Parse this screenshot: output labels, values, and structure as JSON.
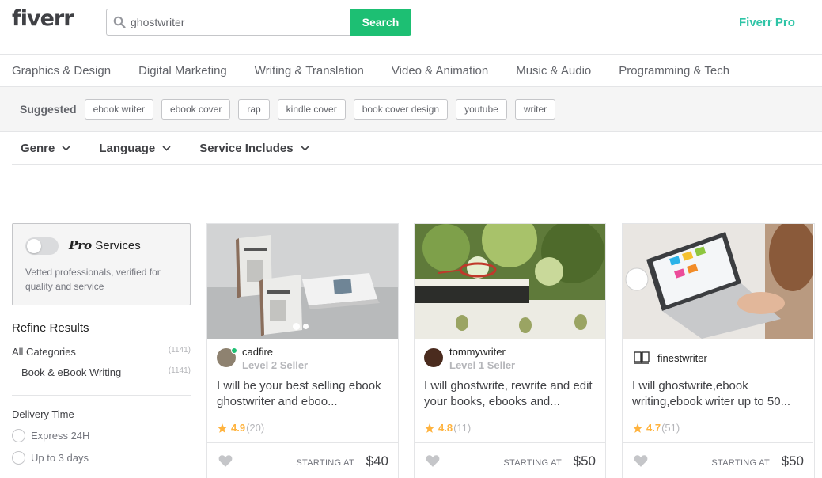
{
  "header": {
    "logo": "fiverr",
    "search_value": "ghostwriter",
    "search_button": "Search",
    "pro_link": "Fiverr Pro"
  },
  "categories": [
    "Graphics & Design",
    "Digital Marketing",
    "Writing & Translation",
    "Video & Animation",
    "Music & Audio",
    "Programming & Tech"
  ],
  "suggested": {
    "label": "Suggested",
    "tags": [
      "ebook writer",
      "ebook cover",
      "rap",
      "kindle cover",
      "book cover design",
      "youtube",
      "writer"
    ]
  },
  "filters": [
    "Genre",
    "Language",
    "Service Includes"
  ],
  "sidebar": {
    "pro_script": "Pro",
    "pro_word": "Services",
    "pro_desc": "Vetted professionals, verified for quality and service",
    "refine_title": "Refine Results",
    "all_categories": "All Categories",
    "all_count": "(1141)",
    "subcategory": "Book & eBook Writing",
    "sub_count": "(1141)",
    "delivery_title": "Delivery Time",
    "delivery_options": [
      "Express 24H",
      "Up to 3 days"
    ]
  },
  "gigs": [
    {
      "seller": "cadfire",
      "level": "Level 2 Seller",
      "title": "I will be your best selling ebook ghostwriter and eboo...",
      "score": "4.9",
      "reviews": "(20)",
      "starting": "STARTING AT",
      "price": "$40"
    },
    {
      "seller": "tommywriter",
      "level": "Level 1 Seller",
      "title": "I will ghostwrite, rewrite and edit your books, ebooks and...",
      "score": "4.8",
      "reviews": "(11)",
      "starting": "STARTING AT",
      "price": "$50"
    },
    {
      "seller": "finestwriter",
      "level": "",
      "title": "I will ghostwrite,ebook writing,ebook writer up to 50...",
      "score": "4.7",
      "reviews": "(51)",
      "starting": "STARTING AT",
      "price": "$50"
    }
  ],
  "colors": {
    "brand_green": "#1dbf73",
    "pro_teal": "#2ec4a6",
    "star": "#ffb33e"
  }
}
